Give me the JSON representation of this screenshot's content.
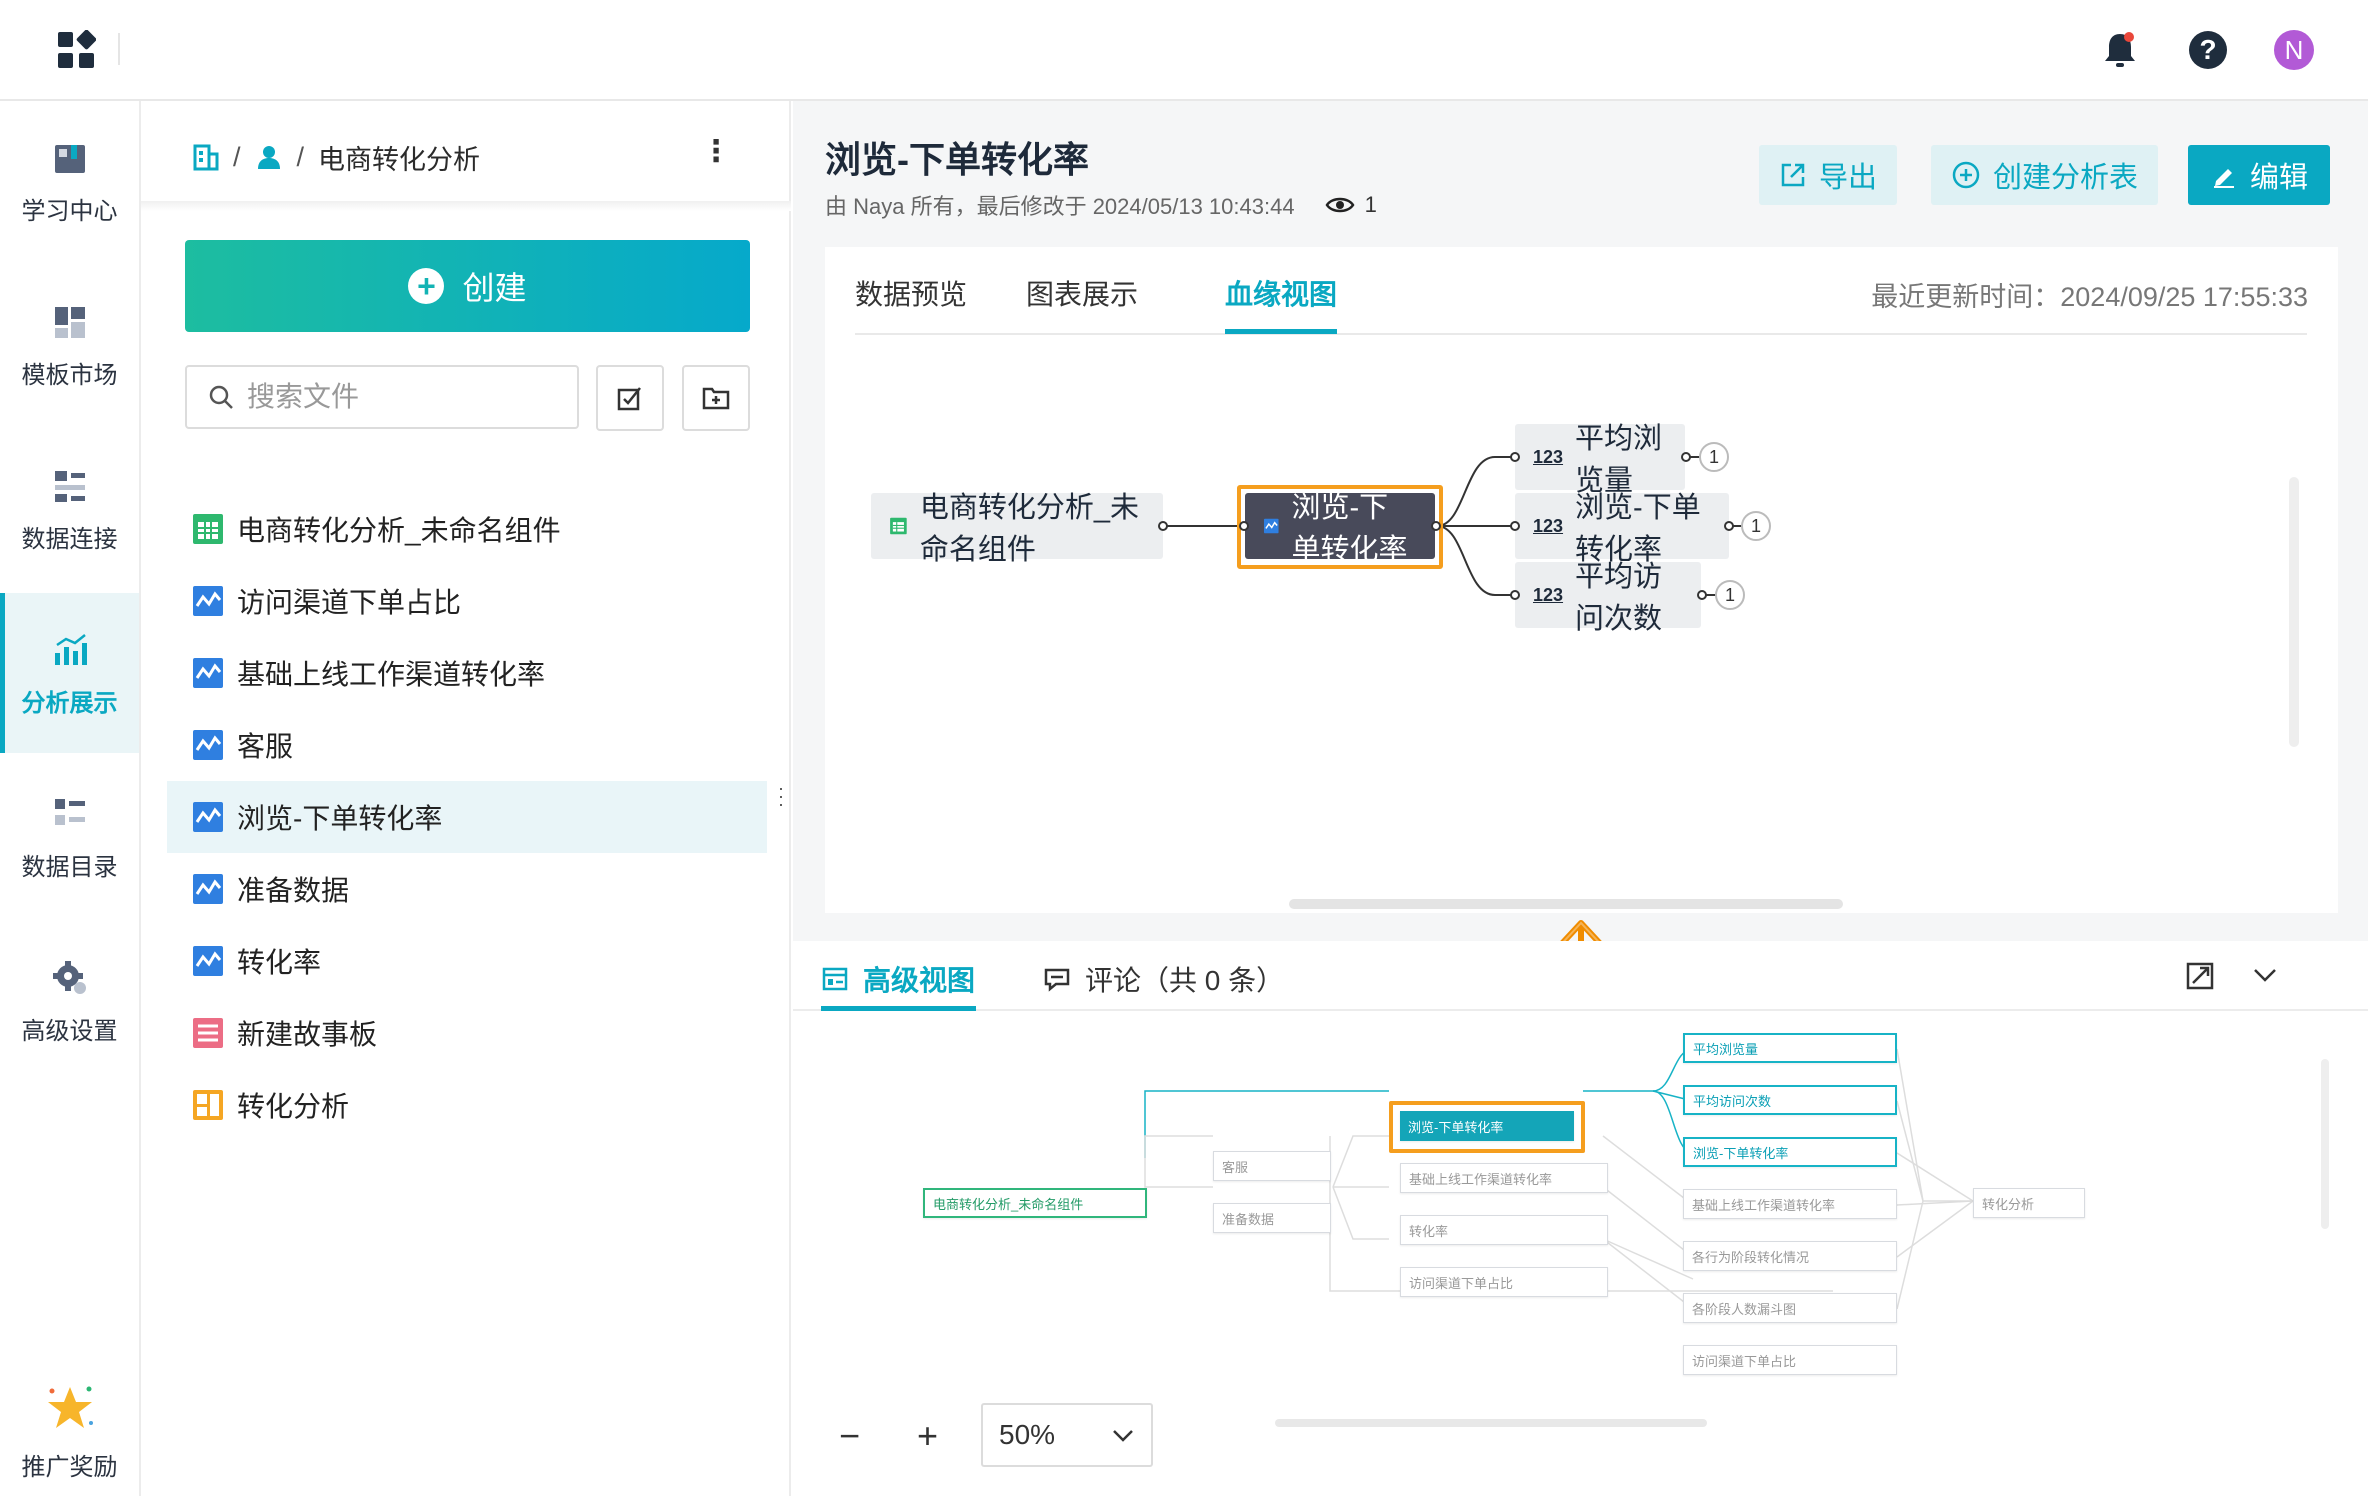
{
  "topbar": {
    "avatar_letter": "N"
  },
  "nav": {
    "items": [
      {
        "label": "学习中心",
        "icon": "learning-center-icon"
      },
      {
        "label": "模板市场",
        "icon": "template-market-icon"
      },
      {
        "label": "数据连接",
        "icon": "data-connection-icon"
      },
      {
        "label": "分析展示",
        "icon": "analysis-display-icon",
        "active": true
      },
      {
        "label": "数据目录",
        "icon": "data-catalog-icon"
      },
      {
        "label": "高级设置",
        "icon": "advanced-settings-icon"
      },
      {
        "label": "推广奖励",
        "icon": "star-reward-icon"
      }
    ]
  },
  "files": {
    "breadcrumb_sep": "/",
    "breadcrumb_folder": "电商转化分析",
    "create_label": "创建",
    "search_placeholder": "搜索文件",
    "items": [
      {
        "label": "电商转化分析_未命名组件",
        "type": "table"
      },
      {
        "label": "访问渠道下单占比",
        "type": "chart"
      },
      {
        "label": "基础上线工作渠道转化率",
        "type": "chart"
      },
      {
        "label": "客服",
        "type": "chart"
      },
      {
        "label": "浏览-下单转化率",
        "type": "chart",
        "selected": true
      },
      {
        "label": "准备数据",
        "type": "chart"
      },
      {
        "label": "转化率",
        "type": "chart"
      },
      {
        "label": "新建故事板",
        "type": "story"
      },
      {
        "label": "转化分析",
        "type": "dashboard"
      }
    ]
  },
  "main": {
    "title": "浏览-下单转化率",
    "meta": "由 Naya 所有，最后修改于 2024/05/13 10:43:44",
    "views": "1",
    "export_label": "导出",
    "create_table_label": "创建分析表",
    "edit_label": "编辑",
    "tabs": [
      "数据预览",
      "图表展示",
      "血缘视图"
    ],
    "active_tab": "血缘视图",
    "updated": "最近更新时间：2024/09/25 17:55:33"
  },
  "lineage": {
    "source": "电商转化分析_未命名组件",
    "center": "浏览-下单转化率",
    "outputs": [
      {
        "label": "平均浏览量",
        "count": "1"
      },
      {
        "label": "浏览-下单转化率",
        "count": "1"
      },
      {
        "label": "平均访问次数",
        "count": "1"
      }
    ]
  },
  "bottom": {
    "tab_advanced": "高级视图",
    "tab_comments": "评论（共 0 条）",
    "zoom_out": "−",
    "zoom_in": "+",
    "zoom_level": "50%"
  },
  "mini_graph": {
    "source": "电商转化分析_未命名组件",
    "level1": [
      "客服",
      "准备数据"
    ],
    "level2": [
      "浏览-下单转化率",
      "基础上线工作渠道转化率",
      "转化率",
      "访问渠道下单占比"
    ],
    "level3": [
      "平均浏览量",
      "平均访问次数",
      "浏览-下单转化率",
      "基础上线工作渠道转化率",
      "各行为阶段转化情况",
      "各阶段人数漏斗图",
      "访问渠道下单占比"
    ],
    "level4": [
      "转化分析"
    ]
  },
  "colors": {
    "accent": "#0aa8c2",
    "highlight": "#f59e1e",
    "center_node": "#484a5a"
  }
}
